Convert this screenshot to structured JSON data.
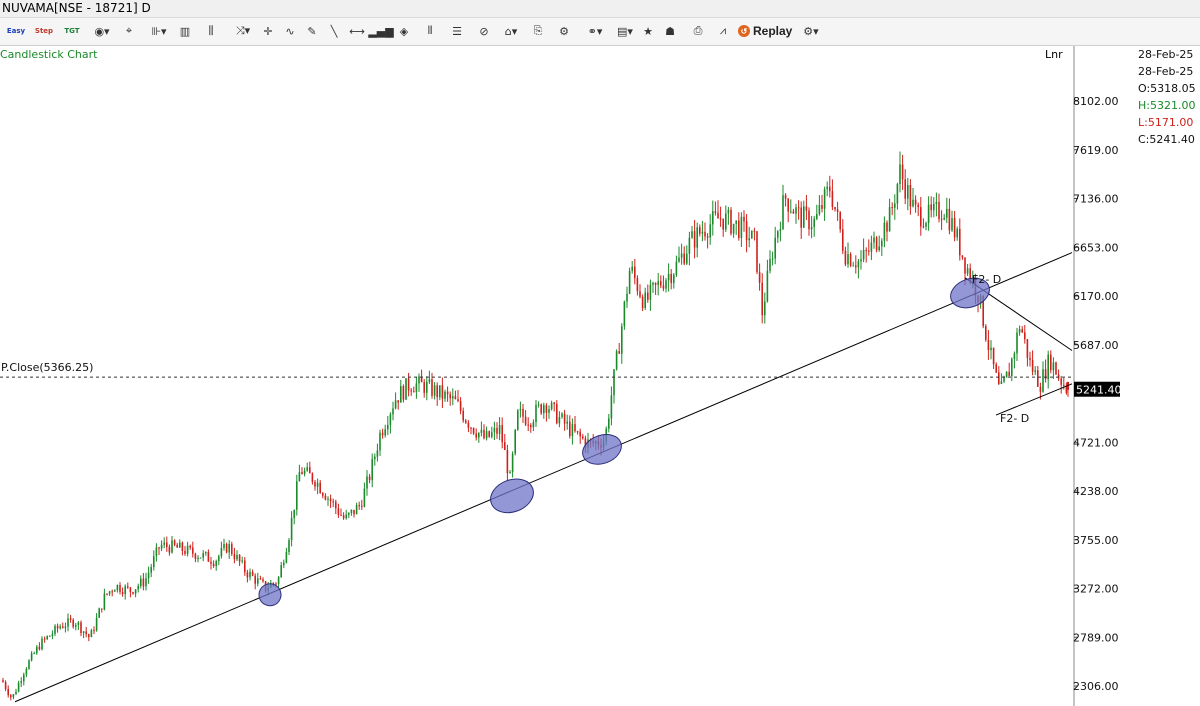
{
  "window": {
    "title": "NUVAMA[NSE - 18721] D"
  },
  "toolbar": {
    "easy_label": "Easy",
    "step_label": "Step",
    "tgt_label": "TGT",
    "replay_label": "Replay"
  },
  "header": {
    "chart_title": "Candlestick Chart",
    "scale_label": "Lnr"
  },
  "ohlc": {
    "date1": "28-Feb-25",
    "date2": "28-Feb-25",
    "open": "O:5318.05",
    "high": "H:5321.00",
    "low": "L:5171.00",
    "close": "C:5241.40"
  },
  "colors": {
    "up": "#1a8a2a",
    "down": "#d0201b",
    "highlight": "#6f74c8",
    "line": "#000000"
  },
  "chart_data": {
    "type": "candlestick",
    "title": "Candlestick Chart",
    "ylim": [
      2150,
      8450
    ],
    "yticks": [
      2306,
      2789,
      3272,
      3755,
      4238,
      4721,
      5204,
      5687,
      6170,
      6653,
      7136,
      7619,
      8102
    ],
    "ytick_labels": [
      "2306.00",
      "2789.00",
      "3272.00",
      "3755.00",
      "4238.00",
      "4721.00",
      "5204.00",
      "5687.00",
      "6170.00",
      "6653.00",
      "7136.00",
      "7619.00",
      "8102.00"
    ],
    "last_price_label": "5241.40",
    "last_price": 5241.4,
    "prev_close": {
      "label": "P.Close(5366.25)",
      "value": 5366.25
    },
    "price_path": [
      [
        0,
        2400
      ],
      [
        12,
        2180
      ],
      [
        25,
        2480
      ],
      [
        40,
        2720
      ],
      [
        60,
        2900
      ],
      [
        75,
        2950
      ],
      [
        90,
        2780
      ],
      [
        105,
        3200
      ],
      [
        115,
        3300
      ],
      [
        130,
        3250
      ],
      [
        145,
        3350
      ],
      [
        160,
        3700
      ],
      [
        175,
        3680
      ],
      [
        195,
        3620
      ],
      [
        215,
        3550
      ],
      [
        228,
        3700
      ],
      [
        245,
        3450
      ],
      [
        265,
        3280
      ],
      [
        278,
        3350
      ],
      [
        290,
        3850
      ],
      [
        300,
        4450
      ],
      [
        315,
        4350
      ],
      [
        330,
        4150
      ],
      [
        345,
        3950
      ],
      [
        360,
        4100
      ],
      [
        370,
        4400
      ],
      [
        380,
        4800
      ],
      [
        395,
        5150
      ],
      [
        410,
        5300
      ],
      [
        425,
        5280
      ],
      [
        440,
        5200
      ],
      [
        455,
        5120
      ],
      [
        470,
        4900
      ],
      [
        485,
        4750
      ],
      [
        500,
        4850
      ],
      [
        510,
        4350
      ],
      [
        518,
        5000
      ],
      [
        530,
        4950
      ],
      [
        545,
        5120
      ],
      [
        560,
        4950
      ],
      [
        575,
        4800
      ],
      [
        590,
        4700
      ],
      [
        605,
        4750
      ],
      [
        610,
        5100
      ],
      [
        620,
        5750
      ],
      [
        630,
        6450
      ],
      [
        645,
        6100
      ],
      [
        660,
        6300
      ],
      [
        675,
        6450
      ],
      [
        690,
        6700
      ],
      [
        705,
        6850
      ],
      [
        720,
        6950
      ],
      [
        740,
        6850
      ],
      [
        755,
        6700
      ],
      [
        762,
        6000
      ],
      [
        772,
        6600
      ],
      [
        785,
        7150
      ],
      [
        800,
        6950
      ],
      [
        815,
        6900
      ],
      [
        830,
        7250
      ],
      [
        845,
        6600
      ],
      [
        860,
        6500
      ],
      [
        875,
        6700
      ],
      [
        890,
        6950
      ],
      [
        900,
        7400
      ],
      [
        915,
        7000
      ],
      [
        930,
        6950
      ],
      [
        945,
        7050
      ],
      [
        955,
        6800
      ],
      [
        965,
        6500
      ],
      [
        978,
        6200
      ],
      [
        990,
        5600
      ],
      [
        1000,
        5200
      ],
      [
        1010,
        5450
      ],
      [
        1020,
        5900
      ],
      [
        1030,
        5500
      ],
      [
        1040,
        5300
      ],
      [
        1050,
        5550
      ],
      [
        1060,
        5350
      ],
      [
        1068,
        5240
      ]
    ],
    "trendlines": [
      {
        "from": [
          15,
          2150
        ],
        "to": [
          1072,
          6600
        ]
      },
      {
        "from": [
          965,
          6350
        ],
        "to": [
          1072,
          5630
        ]
      },
      {
        "from": [
          996,
          4990
        ],
        "to": [
          1072,
          5300
        ]
      }
    ],
    "annotations": [
      {
        "text": "F2- D",
        "x": 1000,
        "y": 4920
      },
      {
        "text": "F2- D",
        "x": 972,
        "y": 6300
      }
    ],
    "highlights": [
      {
        "x": 270,
        "y": 3210,
        "rx": 11,
        "ry": 11
      },
      {
        "x": 512,
        "y": 4190,
        "rx": 22,
        "ry": 16
      },
      {
        "x": 602,
        "y": 4650,
        "rx": 20,
        "ry": 14
      },
      {
        "x": 970,
        "y": 6200,
        "rx": 20,
        "ry": 14
      }
    ]
  }
}
